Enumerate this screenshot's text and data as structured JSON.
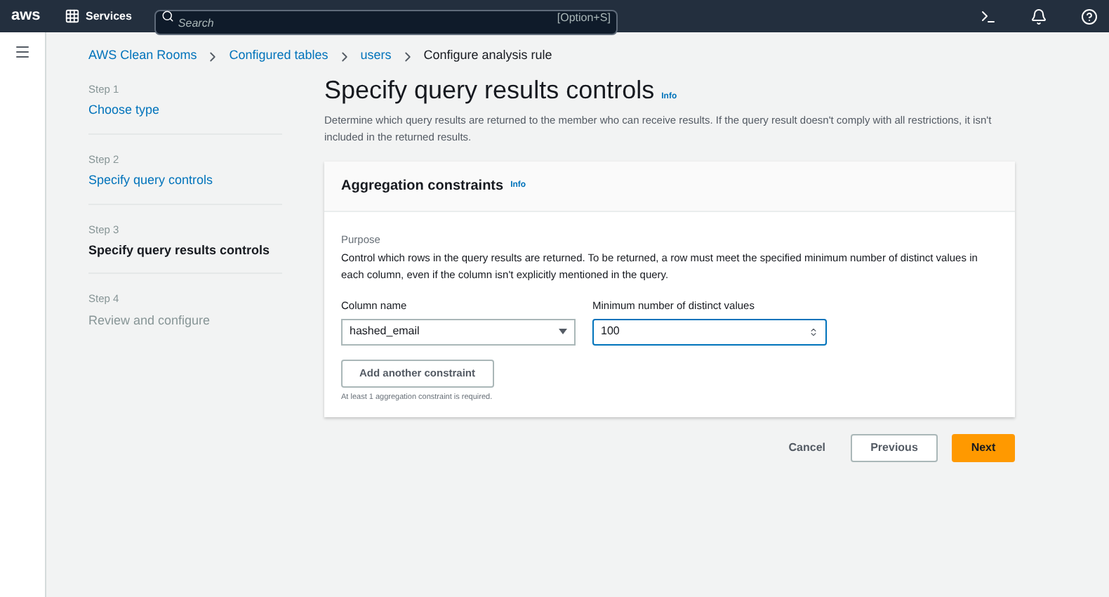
{
  "top_bar": {
    "logo": "aws",
    "services": "Services",
    "search": {
      "placeholder": "Search",
      "shortcut": "[Option+S]"
    }
  },
  "breadcrumbs": [
    {
      "label": "AWS Clean Rooms",
      "current": false
    },
    {
      "label": "Configured tables",
      "current": false
    },
    {
      "label": "users",
      "current": false
    },
    {
      "label": "Configure analysis rule",
      "current": true
    }
  ],
  "steps": [
    {
      "step": "Step 1",
      "label": "Choose type",
      "kind": "link"
    },
    {
      "step": "Step 2",
      "label": "Specify query controls",
      "kind": "link"
    },
    {
      "step": "Step 3",
      "label": "Specify query results controls",
      "kind": "current"
    },
    {
      "step": "Step 4",
      "label": "Review and configure",
      "kind": "disabled"
    }
  ],
  "page": {
    "title": "Specify query results controls",
    "info": "Info",
    "description": "Determine which query results are returned to the member who can receive results. If the query result doesn't comply with all restrictions, it isn't included in the returned results."
  },
  "card": {
    "title": "Aggregation constraints",
    "info": "Info",
    "purpose_label": "Purpose",
    "purpose": "Control which rows in the query results are returned. To be returned, a row must meet the specified minimum number of distinct values in each column, even if the column isn't explicitly mentioned in the query.",
    "column_label": "Column name",
    "column_value": "hashed_email",
    "min_label": "Minimum number of distinct values",
    "min_value": "100",
    "add_button": "Add another constraint",
    "hint": "At least 1 aggregation constraint is required."
  },
  "actions": {
    "cancel": "Cancel",
    "previous": "Previous",
    "next": "Next"
  }
}
